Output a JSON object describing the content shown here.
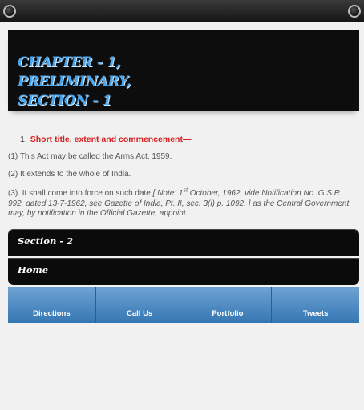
{
  "hero": {
    "lines": [
      "CHAPTER - 1,",
      "PRELIMINARY,",
      "SECTION - 1"
    ]
  },
  "content": {
    "subhead_number": "1.",
    "subhead": "Short title, extent and commencement—",
    "p1": "(1) This Act may be called the Arms Act, 1959.",
    "p2": "(2)  It extends to the whole of India.",
    "p3_start": "(3). It shall come into force on such date ",
    "p3_note_a": "[ Note: 1",
    "p3_note_sup": "st",
    "p3_note_b": " October, 1962, vide Notification No. G.S.R. 992, dated 13-7-1962, see Gazette of India, Pt. II, sec. 3(i) p. 1092. ]",
    "p3_end": " as the Central Government may, by notification in the Official Gazette, appoint."
  },
  "buttons": {
    "section2": "Section - 2",
    "home": "Home"
  },
  "nav": {
    "items": [
      "Directions",
      "Call Us",
      "Portfolio",
      "Tweets"
    ]
  },
  "colors": {
    "hero_text": "#4aa6ee",
    "subhead": "#d61f1f",
    "nav_bg": "#3577b3"
  }
}
